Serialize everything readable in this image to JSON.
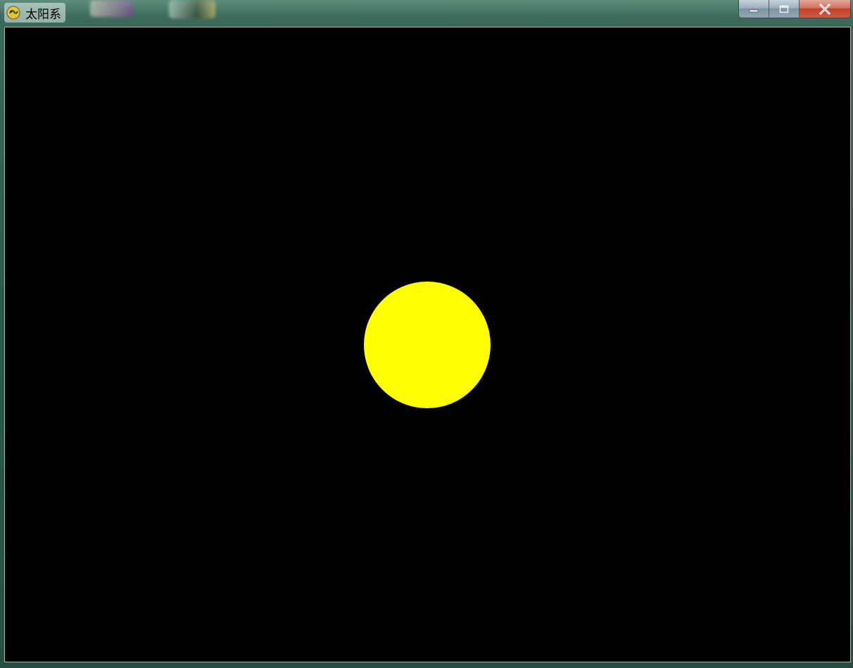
{
  "window": {
    "title": "太阳系",
    "app_icon": "pygame-snake-icon",
    "caption_buttons": [
      "minimize",
      "maximize",
      "close"
    ]
  },
  "desktop_background": [
    "snake-app-shortcut-icon",
    "app-shortcut-icon"
  ],
  "scene": {
    "background_color": "#000000",
    "bodies": [
      {
        "name": "sun",
        "color": "#FFFF00"
      }
    ]
  }
}
